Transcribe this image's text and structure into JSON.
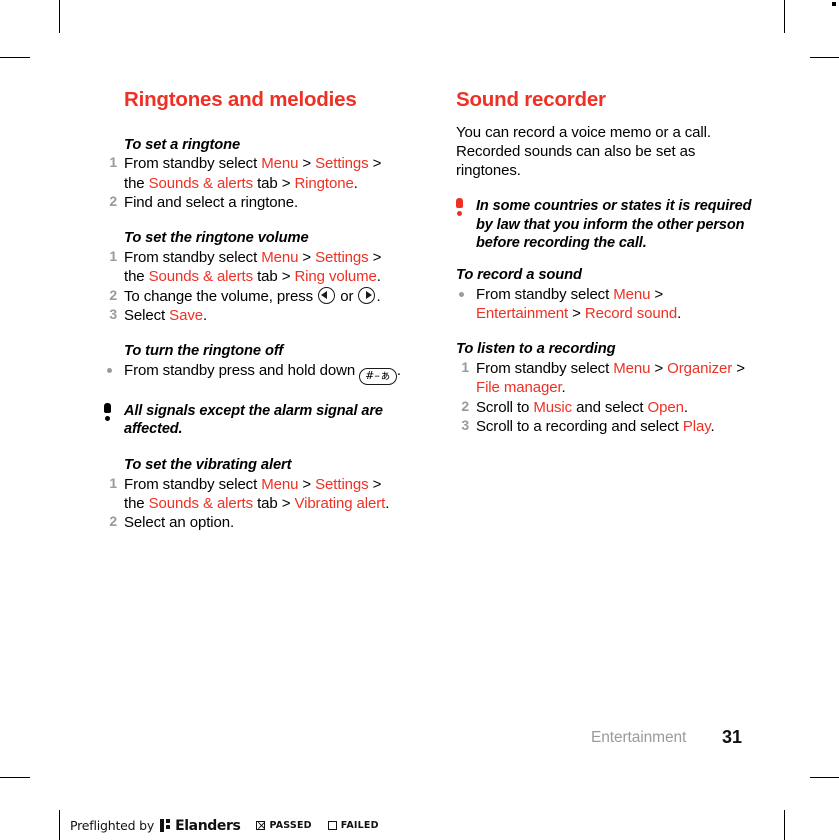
{
  "crop_marks": {
    "present": true
  },
  "left_column": {
    "section_title": "Ringtones and melodies",
    "procedures": [
      {
        "title": "To set a ringtone",
        "type": "ordered",
        "steps": [
          {
            "num": "1",
            "parts": [
              {
                "t": "From standby select ",
                "c": "plain"
              },
              {
                "t": "Menu",
                "c": "ui"
              },
              {
                "t": " > ",
                "c": "plain"
              },
              {
                "t": "Settings",
                "c": "ui"
              },
              {
                "t": " > the ",
                "c": "plain"
              },
              {
                "t": "Sounds & alerts",
                "c": "ui"
              },
              {
                "t": " tab > ",
                "c": "plain"
              },
              {
                "t": "Ringtone",
                "c": "ui"
              },
              {
                "t": ".",
                "c": "plain"
              }
            ]
          },
          {
            "num": "2",
            "parts": [
              {
                "t": "Find and select a ringtone.",
                "c": "plain"
              }
            ]
          }
        ]
      },
      {
        "title": "To set the ringtone volume",
        "type": "ordered",
        "steps": [
          {
            "num": "1",
            "parts": [
              {
                "t": "From standby select ",
                "c": "plain"
              },
              {
                "t": "Menu",
                "c": "ui"
              },
              {
                "t": " > ",
                "c": "plain"
              },
              {
                "t": "Settings",
                "c": "ui"
              },
              {
                "t": " > the ",
                "c": "plain"
              },
              {
                "t": "Sounds & alerts",
                "c": "ui"
              },
              {
                "t": " tab > ",
                "c": "plain"
              },
              {
                "t": "Ring volume",
                "c": "ui"
              },
              {
                "t": ".",
                "c": "plain"
              }
            ]
          },
          {
            "num": "2",
            "parts": [
              {
                "t": "To change the volume, press ",
                "c": "plain"
              },
              {
                "t": "volume-down-key-icon",
                "c": "icon"
              },
              {
                "t": " or ",
                "c": "plain"
              },
              {
                "t": "volume-up-key-icon",
                "c": "icon"
              },
              {
                "t": ".",
                "c": "plain"
              }
            ]
          },
          {
            "num": "3",
            "parts": [
              {
                "t": "Select ",
                "c": "plain"
              },
              {
                "t": "Save",
                "c": "ui"
              },
              {
                "t": ".",
                "c": "plain"
              }
            ]
          }
        ]
      },
      {
        "title": "To turn the ringtone off",
        "type": "bulleted",
        "steps": [
          {
            "num": "",
            "parts": [
              {
                "t": "From standby press and hold down ",
                "c": "plain"
              },
              {
                "t": "hash-key-icon",
                "c": "icon"
              },
              {
                "t": ".",
                "c": "plain"
              }
            ]
          }
        ]
      },
      {
        "title": "To set the vibrating alert",
        "type": "ordered",
        "steps": [
          {
            "num": "1",
            "parts": [
              {
                "t": "From standby select ",
                "c": "plain"
              },
              {
                "t": "Menu",
                "c": "ui"
              },
              {
                "t": " > ",
                "c": "plain"
              },
              {
                "t": "Settings",
                "c": "ui"
              },
              {
                "t": " > the ",
                "c": "plain"
              },
              {
                "t": "Sounds & alerts",
                "c": "ui"
              },
              {
                "t": " tab > ",
                "c": "plain"
              },
              {
                "t": "Vibrating alert",
                "c": "ui"
              },
              {
                "t": ".",
                "c": "plain"
              }
            ]
          },
          {
            "num": "2",
            "parts": [
              {
                "t": "Select an option.",
                "c": "plain"
              }
            ]
          }
        ]
      }
    ],
    "note": "All signals except the alarm signal are affected."
  },
  "right_column": {
    "section_title": "Sound recorder",
    "intro": "You can record a voice memo or a call. Recorded sounds can also be set as ringtones.",
    "note": "In some countries or states it is required by law that you inform the other person before recording the call.",
    "procedures": [
      {
        "title": "To record a sound",
        "type": "bulleted",
        "steps": [
          {
            "num": "",
            "parts": [
              {
                "t": "From standby select ",
                "c": "plain"
              },
              {
                "t": "Menu",
                "c": "ui"
              },
              {
                "t": " > ",
                "c": "plain"
              },
              {
                "t": "Entertainment",
                "c": "ui"
              },
              {
                "t": " > ",
                "c": "plain"
              },
              {
                "t": "Record sound",
                "c": "ui"
              },
              {
                "t": ".",
                "c": "plain"
              }
            ]
          }
        ]
      },
      {
        "title": "To listen to a recording",
        "type": "ordered",
        "steps": [
          {
            "num": "1",
            "parts": [
              {
                "t": "From standby select ",
                "c": "plain"
              },
              {
                "t": "Menu",
                "c": "ui"
              },
              {
                "t": " > ",
                "c": "plain"
              },
              {
                "t": "Organizer",
                "c": "ui"
              },
              {
                "t": " > ",
                "c": "plain"
              },
              {
                "t": "File manager",
                "c": "ui"
              },
              {
                "t": ".",
                "c": "plain"
              }
            ]
          },
          {
            "num": "2",
            "parts": [
              {
                "t": "Scroll to ",
                "c": "plain"
              },
              {
                "t": "Music",
                "c": "ui"
              },
              {
                "t": " and select ",
                "c": "plain"
              },
              {
                "t": "Open",
                "c": "ui"
              },
              {
                "t": ".",
                "c": "plain"
              }
            ]
          },
          {
            "num": "3",
            "parts": [
              {
                "t": "Scroll to a recording and select ",
                "c": "plain"
              },
              {
                "t": "Play",
                "c": "ui"
              },
              {
                "t": ".",
                "c": "plain"
              }
            ]
          }
        ]
      }
    ]
  },
  "footer": {
    "chapter": "Entertainment",
    "page_number": "31"
  },
  "preflight": {
    "prefix": "Preflighted by",
    "brand": "Elanders",
    "passed_label": "PASSED",
    "failed_label": "FAILED",
    "passed_checked": true,
    "failed_checked": false
  },
  "icons": {
    "hash_key_glyph": "#–ぁ",
    "note_icon": "exclamation-icon"
  },
  "colors": {
    "accent_red": "#ee3124",
    "list_number_gray": "#9a9a9a",
    "text_black": "#000000"
  }
}
